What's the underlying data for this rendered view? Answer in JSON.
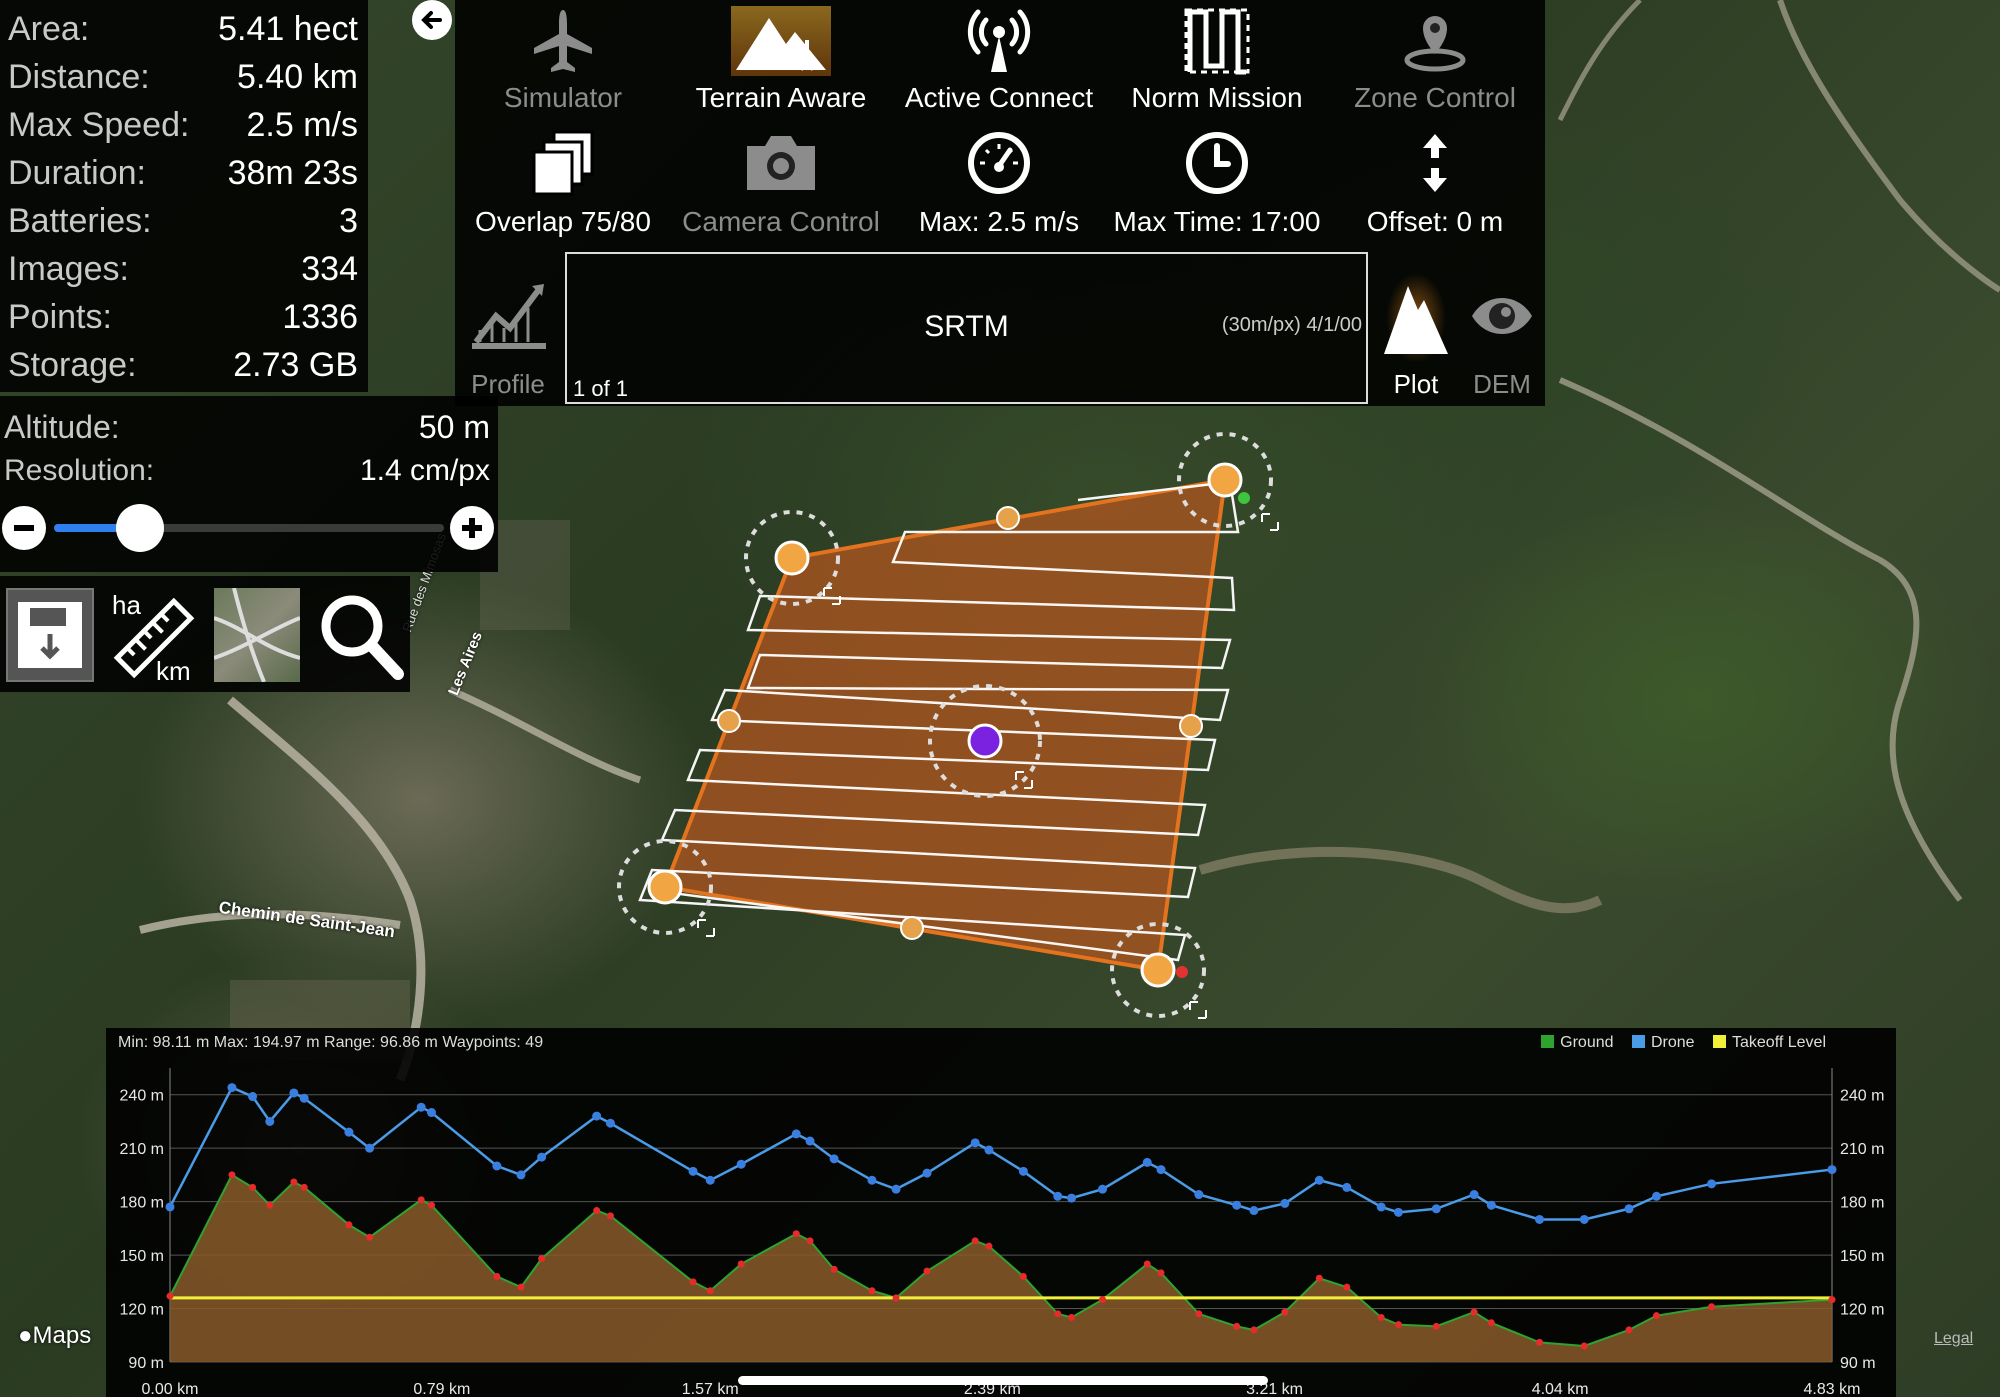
{
  "stats": {
    "area": {
      "label": "Area:",
      "value": "5.41 hect"
    },
    "distance": {
      "label": "Distance:",
      "value": "5.40 km"
    },
    "max_speed": {
      "label": "Max Speed:",
      "value": "2.5 m/s"
    },
    "duration": {
      "label": "Duration:",
      "value": "38m 23s"
    },
    "batteries": {
      "label": "Batteries:",
      "value": "3"
    },
    "images": {
      "label": "Images:",
      "value": "334"
    },
    "points": {
      "label": "Points:",
      "value": "1336"
    },
    "storage": {
      "label": "Storage:",
      "value": "2.73 GB"
    }
  },
  "altitude": {
    "label": "Altitude:",
    "value": "50 m",
    "resolution_label": "Resolution:",
    "resolution_value": "1.4 cm/px",
    "slider_level": 0.22
  },
  "toolbar": {
    "row1": [
      {
        "label": "Simulator",
        "icon": "airplane-icon",
        "enabled": false
      },
      {
        "label": "Terrain Aware",
        "icon": "mountains-icon",
        "enabled": true
      },
      {
        "label": "Active Connect",
        "icon": "antenna-icon",
        "enabled": true
      },
      {
        "label": "Norm Mission",
        "icon": "lawnmower-path-icon",
        "enabled": true
      },
      {
        "label": "Zone Control",
        "icon": "location-pin-icon",
        "enabled": false
      }
    ],
    "row2": [
      {
        "label": "Overlap 75/80",
        "icon": "stacked-layers-icon",
        "enabled": true
      },
      {
        "label": "Camera Control",
        "icon": "camera-icon",
        "enabled": false
      },
      {
        "label": "Max: 2.5 m/s",
        "icon": "speedometer-icon",
        "enabled": true
      },
      {
        "label": "Max Time: 17:00",
        "icon": "clock-icon",
        "enabled": true
      },
      {
        "label": "Offset: 0 m",
        "icon": "up-down-arrows-icon",
        "enabled": true
      }
    ]
  },
  "elevation": {
    "profile_label": "Profile",
    "source": "SRTM",
    "source_detail": "(30m/px) 4/1/00",
    "pager": "1 of 1",
    "plot_label": "Plot",
    "dem_label": "DEM"
  },
  "map_labels": {
    "road1": "Chemin de Saint-Jean",
    "road2": "Les Aires",
    "road3": "Rue des Mimosas",
    "maps_brand": "Maps",
    "legal": "Legal"
  },
  "chart_data": {
    "type": "line",
    "summary": "Min: 98.11 m Max: 194.97 m Range: 96.86 m Waypoints: 49",
    "legend": [
      {
        "name": "Ground",
        "color": "#2ea32e"
      },
      {
        "name": "Drone",
        "color": "#4a9be8"
      },
      {
        "name": "Takeoff Level",
        "color": "#f2ef3a"
      }
    ],
    "ylim": [
      90,
      255
    ],
    "y_ticks": [
      90,
      120,
      150,
      180,
      210,
      240
    ],
    "y_tick_labels": [
      "90 m",
      "120 m",
      "150 m",
      "180 m",
      "210 m",
      "240 m"
    ],
    "xlim": [
      0,
      4.83
    ],
    "x_ticks": [
      0,
      0.79,
      1.57,
      2.39,
      3.21,
      4.04,
      4.83
    ],
    "x_tick_labels": [
      "0.00 km",
      "0.79 km",
      "1.57 km",
      "2.39 km",
      "3.21 km",
      "4.04 km",
      "4.83 km"
    ],
    "takeoff_level": 126,
    "series": [
      {
        "name": "Drone",
        "x": [
          0,
          0.18,
          0.24,
          0.29,
          0.36,
          0.39,
          0.52,
          0.58,
          0.73,
          0.76,
          0.95,
          1.02,
          1.08,
          1.24,
          1.28,
          1.52,
          1.57,
          1.66,
          1.82,
          1.86,
          1.93,
          2.04,
          2.11,
          2.2,
          2.34,
          2.38,
          2.48,
          2.58,
          2.62,
          2.71,
          2.84,
          2.88,
          2.99,
          3.1,
          3.15,
          3.24,
          3.34,
          3.42,
          3.52,
          3.57,
          3.68,
          3.79,
          3.84,
          3.98,
          4.11,
          4.24,
          4.32,
          4.48,
          4.83
        ],
        "y": [
          177,
          244,
          239,
          225,
          241,
          238,
          219,
          210,
          233,
          230,
          200,
          195,
          205,
          228,
          224,
          197,
          192,
          201,
          218,
          214,
          204,
          192,
          187,
          196,
          213,
          209,
          197,
          183,
          182,
          187,
          202,
          198,
          184,
          178,
          175,
          179,
          192,
          188,
          177,
          174,
          176,
          184,
          178,
          170,
          170,
          176,
          183,
          190,
          198
        ]
      },
      {
        "name": "Ground",
        "x": [
          0,
          0.18,
          0.24,
          0.29,
          0.36,
          0.39,
          0.52,
          0.58,
          0.73,
          0.76,
          0.95,
          1.02,
          1.08,
          1.24,
          1.28,
          1.52,
          1.57,
          1.66,
          1.82,
          1.86,
          1.93,
          2.04,
          2.11,
          2.2,
          2.34,
          2.38,
          2.48,
          2.58,
          2.62,
          2.71,
          2.84,
          2.88,
          2.99,
          3.1,
          3.15,
          3.24,
          3.34,
          3.42,
          3.52,
          3.57,
          3.68,
          3.79,
          3.84,
          3.98,
          4.11,
          4.24,
          4.32,
          4.48,
          4.83
        ],
        "y": [
          127,
          195,
          188,
          178,
          191,
          188,
          167,
          160,
          181,
          178,
          138,
          132,
          148,
          175,
          172,
          135,
          130,
          145,
          162,
          158,
          142,
          130,
          126,
          141,
          158,
          155,
          138,
          117,
          115,
          125,
          145,
          140,
          117,
          110,
          108,
          118,
          137,
          132,
          115,
          111,
          110,
          118,
          112,
          101,
          99,
          108,
          116,
          121,
          125
        ]
      }
    ]
  }
}
